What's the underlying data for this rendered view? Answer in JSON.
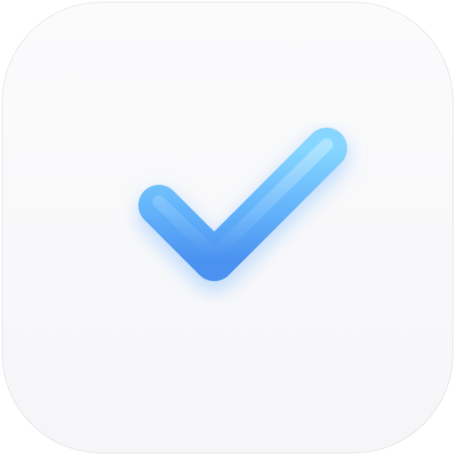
{
  "icon": {
    "name": "checkmark-app-icon",
    "glyph": "checkmark-icon",
    "colors": {
      "background": "#f8f8fa",
      "border": "#e6e6ea",
      "check_top": "#7fd0ff",
      "check_bottom": "#4f96f2",
      "check_glow": "#5aa8ff"
    }
  }
}
